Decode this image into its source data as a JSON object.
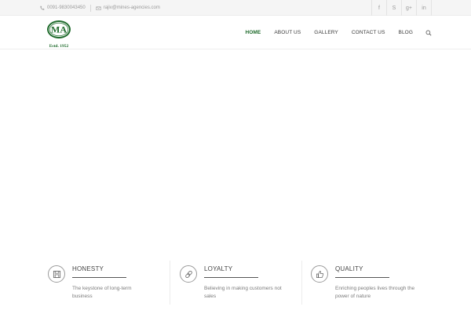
{
  "topbar": {
    "phone": "0091-9830043450",
    "email": "rajiv@mines-agencies.com",
    "social": [
      {
        "icon": "facebook-icon",
        "glyph": "f"
      },
      {
        "icon": "skype-icon",
        "glyph": "S"
      },
      {
        "icon": "google-plus-icon",
        "glyph": "g+"
      },
      {
        "icon": "linkedin-icon",
        "glyph": "in"
      }
    ]
  },
  "header": {
    "logo_letters": "MA",
    "logo_tagline": "Estd. 1952",
    "nav": [
      "HOME",
      "ABOUT US",
      "GALLERY",
      "CONTACT US",
      "BLOG"
    ],
    "active_nav": "HOME"
  },
  "features": [
    {
      "icon": "save-icon",
      "title": "HONESTY",
      "desc": "The keystone of long-term business"
    },
    {
      "icon": "link-icon",
      "title": "LOYALTY",
      "desc": "Believing in making customers not sales"
    },
    {
      "icon": "thumbs-up-icon",
      "title": "QUALITY",
      "desc": "Enriching peoples lives through the power of nature"
    }
  ],
  "colors": {
    "brand_green": "#1f6b2c",
    "topbar_bg": "#f5f5f5",
    "text_muted": "#9a9a9a"
  }
}
